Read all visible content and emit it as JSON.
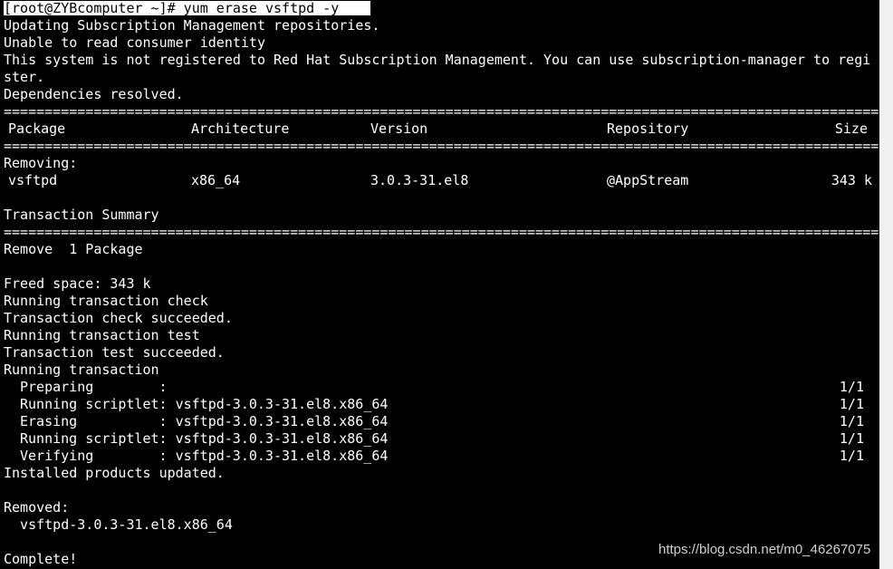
{
  "terminal": {
    "prompt": "[root@ZYBcomputer ~]# yum erase vsftpd -y",
    "lines_top": [
      "Updating Subscription Management repositories.",
      "Unable to read consumer identity",
      "This system is not registered to Red Hat Subscription Management. You can use subscription-manager to regi",
      "ster.",
      "Dependencies resolved."
    ],
    "separator": "============================================================================================================================",
    "table": {
      "headers": {
        "package": "Package",
        "architecture": "Architecture",
        "version": "Version",
        "repository": "Repository",
        "size": "Size"
      },
      "section_label": "Removing:",
      "rows": [
        {
          "package": "vsftpd",
          "architecture": "x86_64",
          "version": "3.0.3-31.el8",
          "repository": "@AppStream",
          "size": "343 k"
        }
      ]
    },
    "transaction_summary": "Transaction Summary",
    "remove_summary": "Remove  1 Package",
    "middle_lines": [
      "Freed space: 343 k",
      "Running transaction check",
      "Transaction check succeeded.",
      "Running transaction test",
      "Transaction test succeeded.",
      "Running transaction"
    ],
    "progress": [
      {
        "text": "Preparing        :",
        "count": "1/1"
      },
      {
        "text": "Running scriptlet: vsftpd-3.0.3-31.el8.x86_64",
        "count": "1/1"
      },
      {
        "text": "Erasing          : vsftpd-3.0.3-31.el8.x86_64",
        "count": "1/1"
      },
      {
        "text": "Running scriptlet: vsftpd-3.0.3-31.el8.x86_64",
        "count": "1/1"
      },
      {
        "text": "Verifying        : vsftpd-3.0.3-31.el8.x86_64",
        "count": "1/1"
      }
    ],
    "installed_updated": "Installed products updated.",
    "removed_label": "Removed:",
    "removed_item": "  vsftpd-3.0.3-31.el8.x86_64",
    "complete": "Complete!"
  },
  "watermark": "https://blog.csdn.net/m0_46267075"
}
